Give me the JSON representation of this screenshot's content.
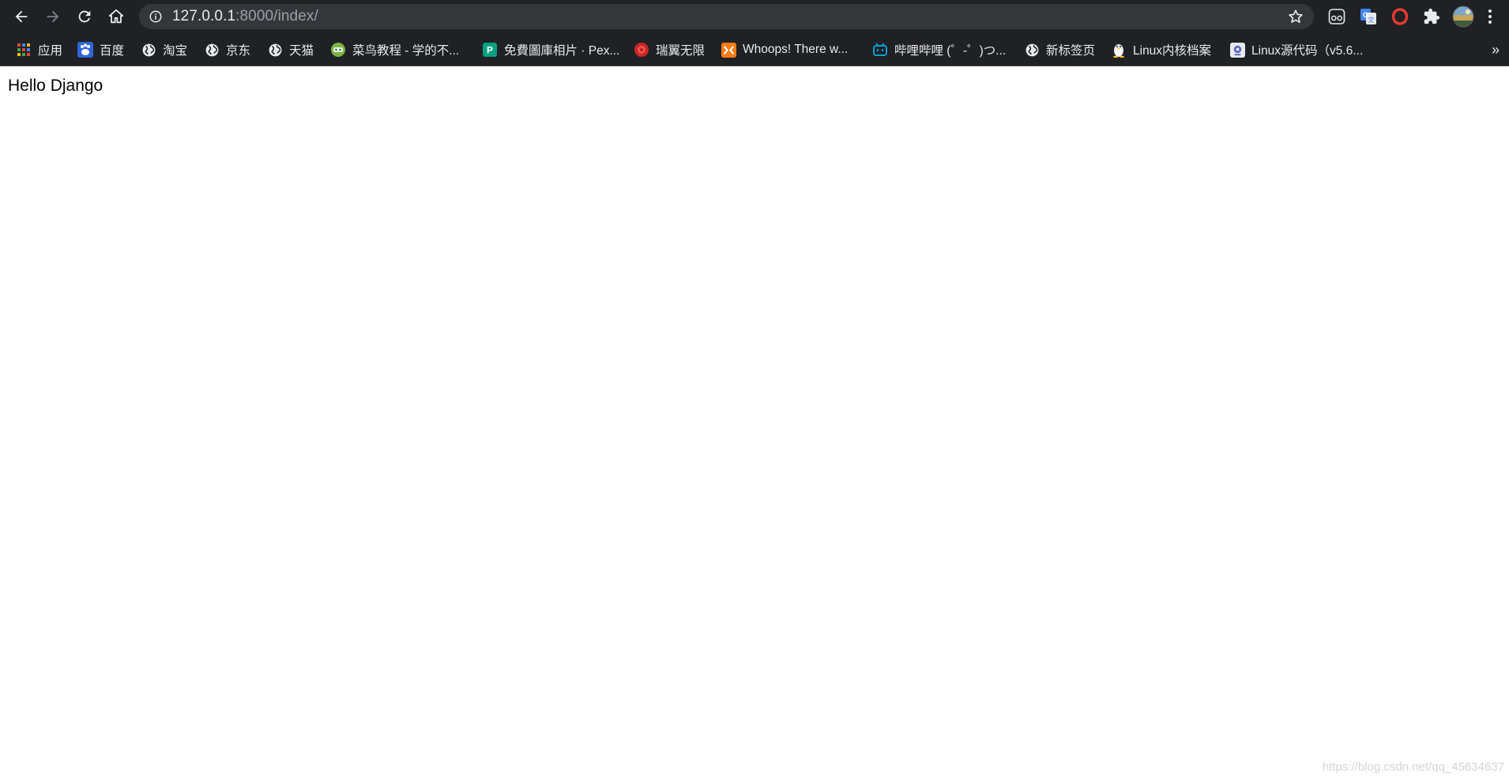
{
  "toolbar": {
    "url_host": "127.0.0.1",
    "url_path": ":8000/index/"
  },
  "bookmarks": [
    {
      "label": "应用",
      "icon": "apps-grid-icon"
    },
    {
      "label": "百度",
      "icon": "baidu-paw-icon"
    },
    {
      "label": "淘宝",
      "icon": "globe-icon"
    },
    {
      "label": "京东",
      "icon": "globe-icon"
    },
    {
      "label": "天猫",
      "icon": "globe-icon"
    },
    {
      "label": "菜鸟教程 - 学的不...",
      "icon": "runoob-icon"
    },
    {
      "label": "免費圖庫相片 · Pex...",
      "icon": "pexels-icon"
    },
    {
      "label": "瑞翼无限",
      "icon": "ruiyi-icon"
    },
    {
      "label": "Whoops! There w...",
      "icon": "whoops-icon"
    },
    {
      "label": "哔哩哔哩 (゜-゜)つ...",
      "icon": "bilibili-icon"
    },
    {
      "label": "新标签页",
      "icon": "globe-icon"
    },
    {
      "label": "Linux内核档案",
      "icon": "tux-icon"
    },
    {
      "label": "Linux源代码（v5.6...",
      "icon": "bootlin-icon"
    }
  ],
  "page": {
    "text": "Hello Django"
  },
  "watermark": "https://blog.csdn.net/qq_45634637",
  "colors": {
    "chrome_dark": "#202124",
    "omnibox": "#35363a",
    "text_light": "#e8eaed",
    "text_dim": "#9aa0a6"
  }
}
